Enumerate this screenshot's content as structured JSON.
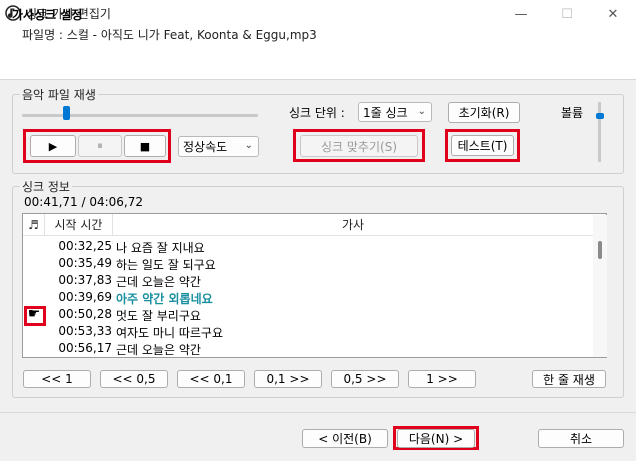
{
  "window": {
    "title": "싱크 가사 편집기",
    "minimize_glyph": "—",
    "maximize_glyph": "☐",
    "close_glyph": "✕"
  },
  "header": {
    "title": "가사싱크 설정",
    "file_label": "파일명 : 스컬 - 아직도 니가 Feat, Koonta & Eggu,mp3"
  },
  "playback": {
    "group_label": "음악 파일 재생",
    "seek_progress": 0.18,
    "sync_unit_label": "싱크 단위 :",
    "sync_unit_value": "1줄 싱크",
    "reset_button": "초기화(R)",
    "volume_label": "볼륨",
    "volume_level": 0.8,
    "speed_value": "정상속도",
    "sync_button": "싱크 맞추기(S)",
    "test_button": "테스트(T)"
  },
  "sync_info": {
    "group_label": "싱크 정보",
    "time_display": "00:41,71 / 04:06,72",
    "columns": [
      "♬",
      "시작 시간",
      "가사"
    ],
    "rows": [
      {
        "time": "00:32,25",
        "lyric": "나 요즘 잘 지내요",
        "marker": "",
        "highlight": false
      },
      {
        "time": "00:35,49",
        "lyric": "하는 일도 잘 되구요",
        "marker": "",
        "highlight": false
      },
      {
        "time": "00:37,83",
        "lyric": "근데 오늘은 약간",
        "marker": "",
        "highlight": false
      },
      {
        "time": "00:39,69",
        "lyric": "아주 약간 외롭네요",
        "marker": "",
        "highlight": true
      },
      {
        "time": "00:50,28",
        "lyric": "멋도 잘 부리구요",
        "marker": "☛",
        "highlight": false
      },
      {
        "time": "00:53,33",
        "lyric": "여자도 마니 따르구요",
        "marker": "",
        "highlight": false
      },
      {
        "time": "00:56,17",
        "lyric": "근데 오늘은 약간",
        "marker": "",
        "highlight": false
      }
    ]
  },
  "nav_buttons": {
    "back_1": "<< 1",
    "back_05": "<< 0,5",
    "back_01": "<< 0,1",
    "fwd_01": "0,1 >>",
    "fwd_05": "0,5 >>",
    "fwd_1": "1 >>",
    "play_line": "한 줄 재생"
  },
  "footer": {
    "prev_button": "< 이전(B)",
    "next_button": "다음(N) >",
    "cancel_button": "취소"
  },
  "icons": {
    "play": "▶",
    "pause": "⏸",
    "stop": "■",
    "dropdown": "⌄"
  },
  "colors": {
    "highlight_lyric": "#1a8fa0",
    "annotation_red": "#e0001b",
    "accent": "#0078d4"
  }
}
